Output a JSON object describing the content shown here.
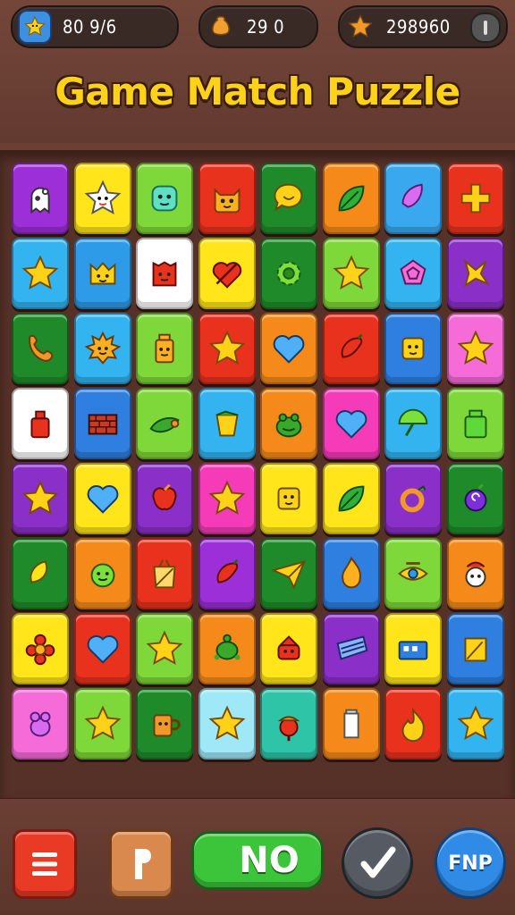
{
  "hud": {
    "stars": "80 9/6",
    "coins": "29 0",
    "score": "298960"
  },
  "title": "Game Match Puzzle",
  "buttons": {
    "no_label": "NO",
    "find_label": "FNP"
  },
  "board": {
    "rows": [
      [
        {
          "color": "#9c2fd8",
          "icon": "ghost-icon"
        },
        {
          "color": "#ffe51a",
          "icon": "star-face-icon"
        },
        {
          "color": "#7fd83a",
          "icon": "slime-icon"
        },
        {
          "color": "#e8321e",
          "icon": "cat-face-icon"
        },
        {
          "color": "#1f8a2a",
          "icon": "speech-bubble-icon"
        },
        {
          "color": "#f58a1a",
          "icon": "leaf-icon"
        },
        {
          "color": "#3aa8ee",
          "icon": "gem-icon"
        },
        {
          "color": "#e8321e",
          "icon": "plus-icon"
        }
      ],
      [
        {
          "color": "#33b3f0",
          "icon": "star-icon"
        },
        {
          "color": "#2e9be8",
          "icon": "crown-face-icon"
        },
        {
          "color": "#ffffff",
          "icon": "red-block-icon"
        },
        {
          "color": "#ffe51a",
          "icon": "heart-slash-icon"
        },
        {
          "color": "#1f8a2a",
          "icon": "gear-icon"
        },
        {
          "color": "#7fd83a",
          "icon": "star-icon"
        },
        {
          "color": "#33b3f0",
          "icon": "pentagon-icon"
        },
        {
          "color": "#8a2fc8",
          "icon": "x-star-icon"
        }
      ],
      [
        {
          "color": "#1f8a2a",
          "icon": "phone-icon"
        },
        {
          "color": "#33b3f0",
          "icon": "sun-face-icon"
        },
        {
          "color": "#7fd83a",
          "icon": "jar-face-icon"
        },
        {
          "color": "#e8321e",
          "icon": "star-icon"
        },
        {
          "color": "#f58a1a",
          "icon": "heart-icon"
        },
        {
          "color": "#e8321e",
          "icon": "pepper-icon"
        },
        {
          "color": "#2e7fe0",
          "icon": "block-face-icon"
        },
        {
          "color": "#f56cd8",
          "icon": "star-icon"
        }
      ],
      [
        {
          "color": "#ffffff",
          "icon": "bottle-icon"
        },
        {
          "color": "#2e7fe0",
          "icon": "brick-icon"
        },
        {
          "color": "#7fd83a",
          "icon": "cucumber-icon"
        },
        {
          "color": "#33b3f0",
          "icon": "bucket-icon"
        },
        {
          "color": "#f58a1a",
          "icon": "frog-icon"
        },
        {
          "color": "#f53bb8",
          "icon": "heart-icon"
        },
        {
          "color": "#33b3f0",
          "icon": "umbrella-icon"
        },
        {
          "color": "#7fd83a",
          "icon": "jar-icon"
        }
      ],
      [
        {
          "color": "#8a2fc8",
          "icon": "star-icon"
        },
        {
          "color": "#ffe51a",
          "icon": "heart-icon"
        },
        {
          "color": "#8a2fc8",
          "icon": "apple-icon"
        },
        {
          "color": "#f53bb8",
          "icon": "star-icon"
        },
        {
          "color": "#ffe51a",
          "icon": "block-face-icon"
        },
        {
          "color": "#ffe51a",
          "icon": "leaf-icon"
        },
        {
          "color": "#8a2fc8",
          "icon": "ring-icon"
        },
        {
          "color": "#1f8a2a",
          "icon": "swirl-icon"
        }
      ],
      [
        {
          "color": "#1f8a2a",
          "icon": "lemon-icon"
        },
        {
          "color": "#f58a1a",
          "icon": "face-icon"
        },
        {
          "color": "#e8321e",
          "icon": "bag-icon"
        },
        {
          "color": "#9c2fd8",
          "icon": "pepper-icon"
        },
        {
          "color": "#1f8a2a",
          "icon": "paper-plane-icon"
        },
        {
          "color": "#2e7fe0",
          "icon": "flame-icon"
        },
        {
          "color": "#7fd83a",
          "icon": "eye-icon"
        },
        {
          "color": "#f58a1a",
          "icon": "cow-face-icon"
        }
      ],
      [
        {
          "color": "#ffe51a",
          "icon": "flower-icon"
        },
        {
          "color": "#e8321e",
          "icon": "heart-icon"
        },
        {
          "color": "#7fd83a",
          "icon": "star-icon"
        },
        {
          "color": "#f58a1a",
          "icon": "turtle-icon"
        },
        {
          "color": "#ffe51a",
          "icon": "hat-face-icon"
        },
        {
          "color": "#8a2fc8",
          "icon": "keyboard-icon"
        },
        {
          "color": "#ffe51a",
          "icon": "briefcase-icon"
        },
        {
          "color": "#2e7fe0",
          "icon": "note-icon"
        }
      ],
      [
        {
          "color": "#f56cd8",
          "icon": "bird-icon"
        },
        {
          "color": "#7fd83a",
          "icon": "star-icon"
        },
        {
          "color": "#1f8a2a",
          "icon": "mug-icon"
        },
        {
          "color": "#9ee8f8",
          "icon": "star-icon"
        },
        {
          "color": "#2ec4a8",
          "icon": "acorn-icon"
        },
        {
          "color": "#f58a1a",
          "icon": "cup-icon"
        },
        {
          "color": "#e8321e",
          "icon": "fire-icon"
        },
        {
          "color": "#33b3f0",
          "icon": "star-icon"
        }
      ]
    ]
  }
}
